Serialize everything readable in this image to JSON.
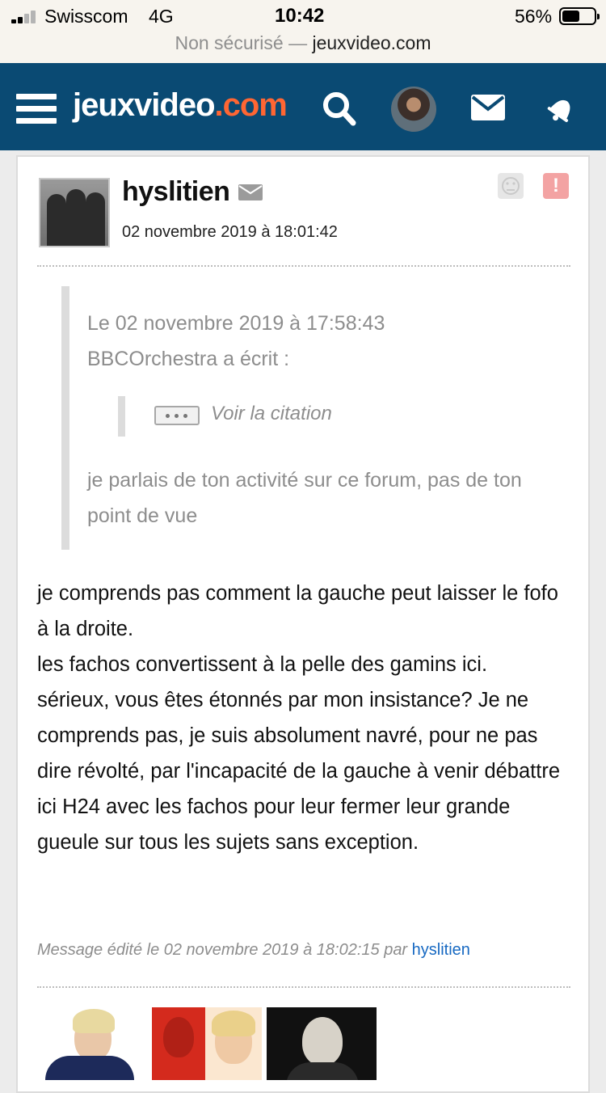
{
  "status_bar": {
    "carrier": "Swisscom",
    "network": "4G",
    "time": "10:42",
    "battery_percent": "56%",
    "battery_level": 0.56
  },
  "url_bar": {
    "security": "Non sécurisé",
    "separator": "—",
    "domain": "jeuxvideo.com"
  },
  "header": {
    "logo_part1": "jeuxvideo",
    "logo_part2": ".com",
    "icons": [
      "menu-icon",
      "search-icon",
      "avatar",
      "mail-icon",
      "bell-icon"
    ],
    "colors": {
      "bg": "#0a4a73",
      "logo_accent": "#ff6633"
    }
  },
  "post": {
    "author": "hyslitien",
    "date": "02 novembre 2019 à 18:01:42",
    "quote": {
      "header_line1": "Le 02 novembre 2019 à 17:58:43",
      "header_line2": "BBCOrchestra a écrit :",
      "nested_label": "Voir la citation",
      "body": "je parlais de ton activité sur ce forum, pas de ton point de vue"
    },
    "message_lines": [
      "je comprends pas comment la gauche peut laisser le fofo à la droite.",
      "les fachos convertissent à la pelle des gamins ici.",
      "sérieux, vous êtes étonnés par mon insistance? Je ne comprends pas, je suis absolument navré, pour ne pas dire révolté, par l'incapacité de la gauche à venir débattre ici H24 avec les fachos pour leur fermer leur grande gueule sur tous les sujets sans exception."
    ],
    "edited_prefix": "Message édité le 02 novembre 2019 à 18:02:15 par",
    "edited_by": "hyslitien",
    "link_color": "#1769c2"
  }
}
